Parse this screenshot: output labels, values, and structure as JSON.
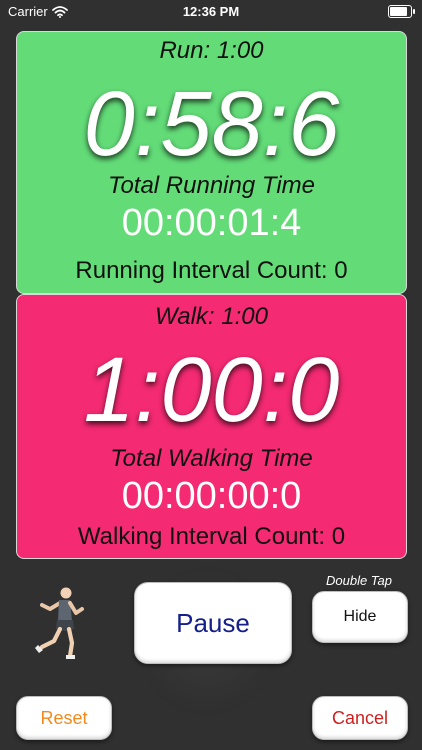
{
  "status_bar": {
    "carrier": "Carrier",
    "time": "12:36 PM"
  },
  "run_panel": {
    "title": "Run:  1:00",
    "countdown": "0:58:6",
    "total_label": "Total Running Time",
    "total_time": "00:00:01:4",
    "interval_count": "Running Interval Count: 0"
  },
  "walk_panel": {
    "title": "Walk:  1:00",
    "countdown": "1:00:0",
    "total_label": "Total Walking Time",
    "total_time": "00:00:00:0",
    "interval_count": "Walking Interval Count: 0"
  },
  "controls": {
    "pause_label": "Pause",
    "double_tap_hint": "Double Tap",
    "hide_label": "Hide",
    "reset_label": "Reset",
    "cancel_label": "Cancel"
  },
  "colors": {
    "run_panel": "#63dc78",
    "walk_panel": "#f42a72",
    "pause_text": "#17208a",
    "reset_text": "#f08a1c",
    "cancel_text": "#d01f1f",
    "background": "#303030"
  },
  "icons": {
    "runner": "runner-figure-icon",
    "wifi": "wifi-icon",
    "battery": "battery-icon"
  },
  "battery_level": 0.95
}
